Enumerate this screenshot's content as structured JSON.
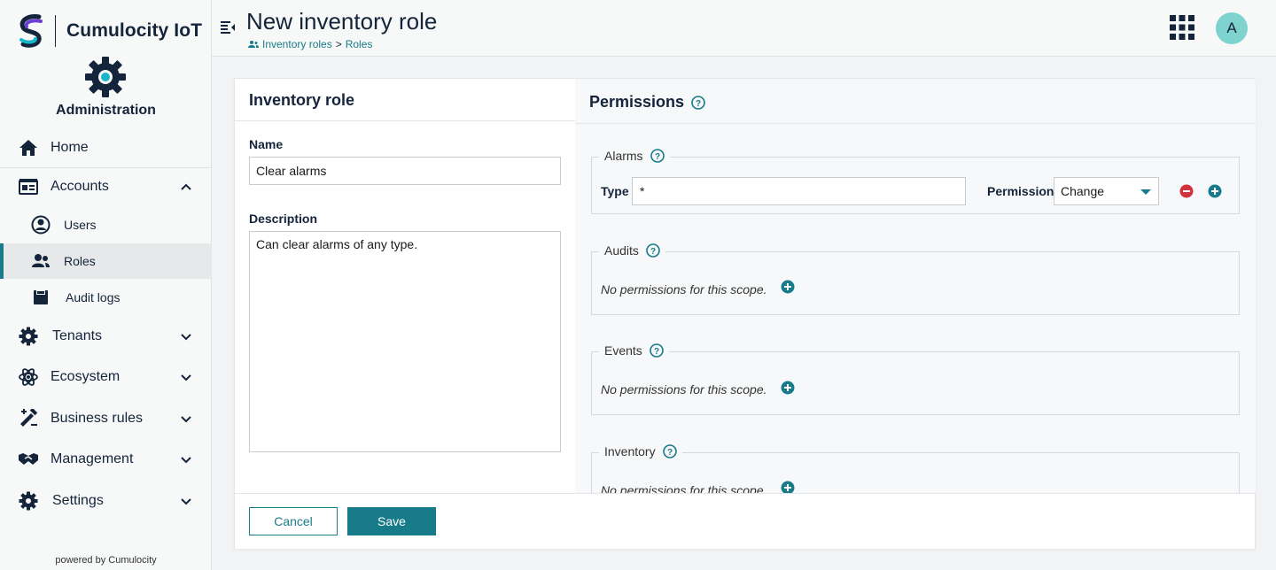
{
  "brand": {
    "name": "Cumulocity IoT",
    "logo_icon": "cumulocity-logo",
    "powered_by": "powered by Cumulocity"
  },
  "app": {
    "name": "Administration",
    "icon": "gear-icon"
  },
  "sidebar": {
    "items": [
      {
        "label": "Home",
        "icon": "home-icon"
      },
      {
        "label": "Accounts",
        "icon": "accounts-icon",
        "expanded": true
      },
      {
        "label": "Users",
        "icon": "user-circle-icon"
      },
      {
        "label": "Roles",
        "icon": "roles-icon",
        "active": true
      },
      {
        "label": "Audit logs",
        "icon": "audit-log-icon"
      },
      {
        "label": "Tenants",
        "icon": "gear-icon"
      },
      {
        "label": "Ecosystem",
        "icon": "ecosystem-icon"
      },
      {
        "label": "Business rules",
        "icon": "business-rules-icon"
      },
      {
        "label": "Management",
        "icon": "handshake-icon"
      },
      {
        "label": "Settings",
        "icon": "gear-icon"
      }
    ]
  },
  "header": {
    "title": "New inventory role",
    "breadcrumb": {
      "first": "Inventory roles",
      "separator": ">",
      "second": "Roles"
    },
    "avatar_initial": "A"
  },
  "form": {
    "title": "Inventory role",
    "name_label": "Name",
    "name_value": "Clear alarms",
    "description_label": "Description",
    "description_value": "Can clear alarms of any type."
  },
  "permissions": {
    "title": "Permissions",
    "scopes": [
      {
        "name": "Alarms",
        "type_label": "Type",
        "type_value": "*",
        "permission_label": "Permission",
        "permission_value": "Change"
      },
      {
        "name": "Audits",
        "empty_text": "No permissions for this scope."
      },
      {
        "name": "Events",
        "empty_text": "No permissions for this scope."
      },
      {
        "name": "Inventory",
        "empty_text": "No permissions for this scope."
      }
    ]
  },
  "footer": {
    "cancel_label": "Cancel",
    "save_label": "Save"
  },
  "colors": {
    "accent": "#177b8a",
    "danger": "#d0343c",
    "avatar": "#7fd3cf",
    "text": "#14243a"
  }
}
